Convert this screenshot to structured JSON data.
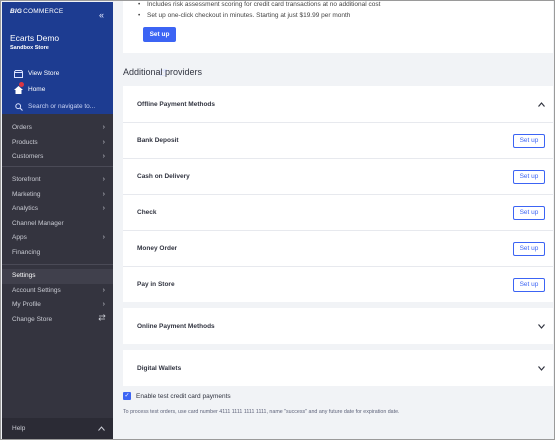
{
  "sidebar": {
    "logo_mark": "BIG",
    "logo_text": "COMMERCE",
    "collapse_icon": "«",
    "store_name": "Ecarts Demo",
    "store_subtitle": "Sandbox Store",
    "view_store_label": "View Store",
    "home_label": "Home",
    "search_placeholder": "Search or navigate to...",
    "nav_group1": [
      {
        "label": "Orders"
      },
      {
        "label": "Products"
      },
      {
        "label": "Customers"
      }
    ],
    "nav_group2": [
      {
        "label": "Storefront"
      },
      {
        "label": "Marketing"
      },
      {
        "label": "Analytics"
      },
      {
        "label": "Channel Manager"
      },
      {
        "label": "Apps"
      },
      {
        "label": "Financing"
      }
    ],
    "nav_group3": [
      {
        "label": "Settings"
      },
      {
        "label": "Account Settings"
      },
      {
        "label": "My Profile"
      },
      {
        "label": "Change Store"
      }
    ],
    "help_label": "Help"
  },
  "main": {
    "bullets": [
      "Includes risk assessment scoring for credit card transactions at no additional cost",
      "Set up one-click checkout in minutes. Starting at just $19.99 per month"
    ],
    "primary_setup_label": "Set up",
    "additional_providers_title": "Additional providers",
    "offline_panel_title": "Offline Payment Methods",
    "offline_methods": [
      {
        "label": "Bank Deposit",
        "button": "Set up"
      },
      {
        "label": "Cash on Delivery",
        "button": "Set up"
      },
      {
        "label": "Check",
        "button": "Set up"
      },
      {
        "label": "Money Order",
        "button": "Set up"
      },
      {
        "label": "Pay in Store",
        "button": "Set up"
      }
    ],
    "online_panel_title": "Online Payment Methods",
    "wallets_panel_title": "Digital Wallets",
    "test_cc_label": "Enable test credit card payments",
    "test_cc_checked": true,
    "test_hint": "To process test orders, use card number 4111 1111 1111 1111, name \"success\" and any future date for expiration date."
  },
  "colors": {
    "sidebar_top": "#1d3c91",
    "sidebar_bg": "#34343f",
    "accent": "#3c64f4"
  }
}
